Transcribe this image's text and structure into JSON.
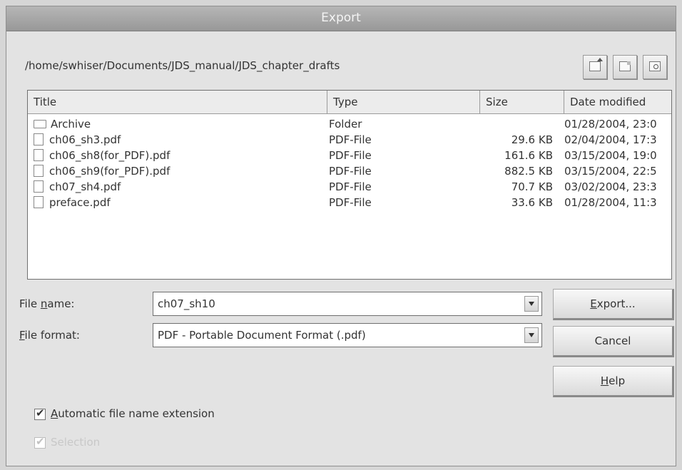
{
  "window": {
    "title": "Export"
  },
  "path": "/home/swhiser/Documents/JDS_manual/JDS_chapter_drafts",
  "toolbar": {
    "icons": [
      "folder-up-icon",
      "new-folder-icon",
      "default-directory-icon"
    ]
  },
  "columns": {
    "title": "Title",
    "type": "Type",
    "size": "Size",
    "date": "Date modified"
  },
  "files": [
    {
      "name": "Archive",
      "type": "Folder",
      "size": "",
      "date": "01/28/2004, 23:0",
      "icon": "folder-icon"
    },
    {
      "name": "ch06_sh3.pdf",
      "type": "PDF-File",
      "size": "29.6 KB",
      "date": "02/04/2004, 17:3",
      "icon": "file-icon"
    },
    {
      "name": "ch06_sh8(for_PDF).pdf",
      "type": "PDF-File",
      "size": "161.6 KB",
      "date": "03/15/2004, 19:0",
      "icon": "file-icon"
    },
    {
      "name": "ch06_sh9(for_PDF).pdf",
      "type": "PDF-File",
      "size": "882.5 KB",
      "date": "03/15/2004, 22:5",
      "icon": "file-icon"
    },
    {
      "name": "ch07_sh4.pdf",
      "type": "PDF-File",
      "size": "70.7 KB",
      "date": "03/02/2004, 23:3",
      "icon": "file-icon"
    },
    {
      "name": "preface.pdf",
      "type": "PDF-File",
      "size": "33.6 KB",
      "date": "01/28/2004, 11:3",
      "icon": "file-icon"
    }
  ],
  "filename": {
    "label_pre": "File ",
    "label_accel": "n",
    "label_post": "ame:",
    "value": "ch07_sh10"
  },
  "fileformat": {
    "label_pre": "",
    "label_accel": "F",
    "label_post": "ile format:",
    "value": "PDF - Portable Document Format (.pdf)"
  },
  "buttons": {
    "export": {
      "pre": "",
      "accel": "E",
      "post": "xport..."
    },
    "cancel": {
      "label": "Cancel"
    },
    "help": {
      "pre": "",
      "accel": "H",
      "post": "elp"
    }
  },
  "options": {
    "auto_ext": {
      "pre": "",
      "accel": "A",
      "post": "utomatic file name extension",
      "checked": true
    },
    "filter": {
      "label": "Selection",
      "checked": true,
      "disabled": true
    }
  }
}
